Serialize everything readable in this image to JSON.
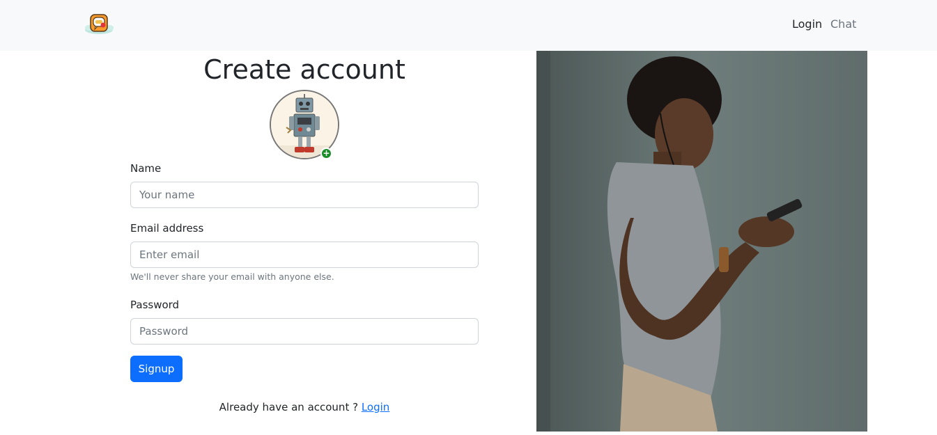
{
  "navbar": {
    "logo_icon": "chat-bubble-app-logo",
    "links": [
      {
        "label": "Login",
        "active": true
      },
      {
        "label": "Chat",
        "active": false
      }
    ]
  },
  "form": {
    "title": "Create account",
    "avatar_icon": "robot-avatar",
    "avatar_add_icon": "plus-icon",
    "name": {
      "label": "Name",
      "placeholder": "Your name",
      "value": ""
    },
    "email": {
      "label": "Email address",
      "placeholder": "Enter email",
      "value": "",
      "help": "We'll never share your email with anyone else."
    },
    "password": {
      "label": "Password",
      "placeholder": "Password",
      "value": ""
    },
    "submit_label": "Signup",
    "footer_text": "Already have an account ?",
    "footer_link": "Login"
  },
  "hero_image": {
    "icon": "person-with-phone-photo"
  },
  "colors": {
    "primary": "#0d6efd",
    "navbar_bg": "#f8f9fa",
    "success_badge": "#198d2a"
  }
}
